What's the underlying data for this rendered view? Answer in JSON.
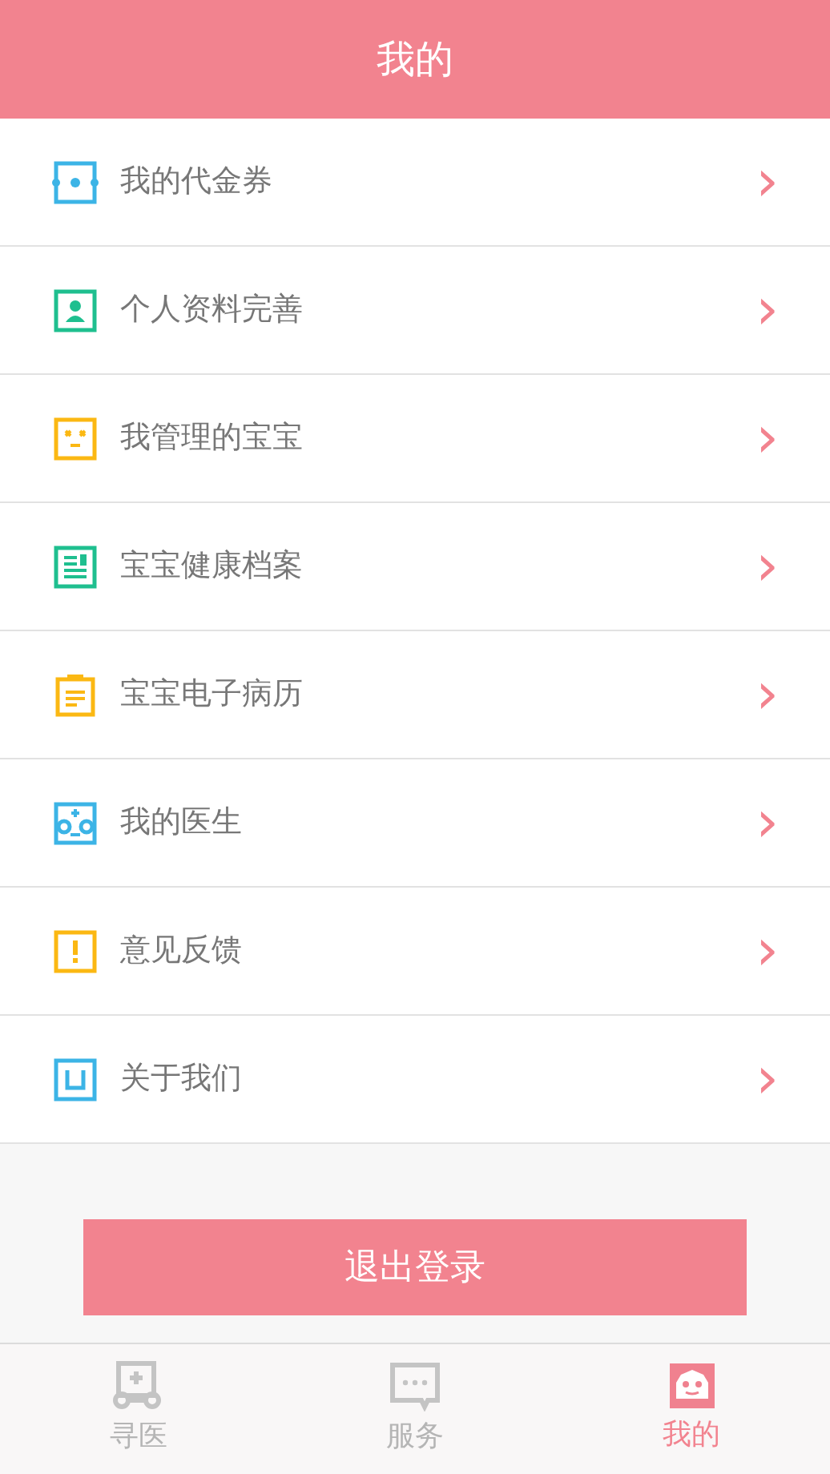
{
  "header": {
    "title": "我的"
  },
  "menu": [
    {
      "label": "我的代金券",
      "kind": "coupon",
      "color": "#3cb4e6",
      "arrow": "›"
    },
    {
      "label": "个人资料完善",
      "kind": "profile",
      "color": "#1fbf8f",
      "arrow": "›"
    },
    {
      "label": "我管理的宝宝",
      "kind": "baby",
      "color": "#fbb813",
      "arrow": "›"
    },
    {
      "label": "宝宝健康档案",
      "kind": "record",
      "color": "#1fbf8f",
      "arrow": "›"
    },
    {
      "label": "宝宝电子病历",
      "kind": "clipboard",
      "color": "#fbb813",
      "arrow": "›"
    },
    {
      "label": "我的医生",
      "kind": "doctor",
      "color": "#3cb4e6",
      "arrow": "›"
    },
    {
      "label": "意见反馈",
      "kind": "feedback",
      "color": "#fbb813",
      "arrow": "›"
    },
    {
      "label": "关于我们",
      "kind": "about",
      "color": "#3cb4e6",
      "arrow": "›"
    }
  ],
  "logout_button": "退出登录",
  "tabs": [
    {
      "label": "寻医",
      "kind": "hospital",
      "selected": false
    },
    {
      "label": "服务",
      "kind": "chat",
      "selected": false
    },
    {
      "label": "我的",
      "kind": "robot",
      "selected": true
    }
  ]
}
